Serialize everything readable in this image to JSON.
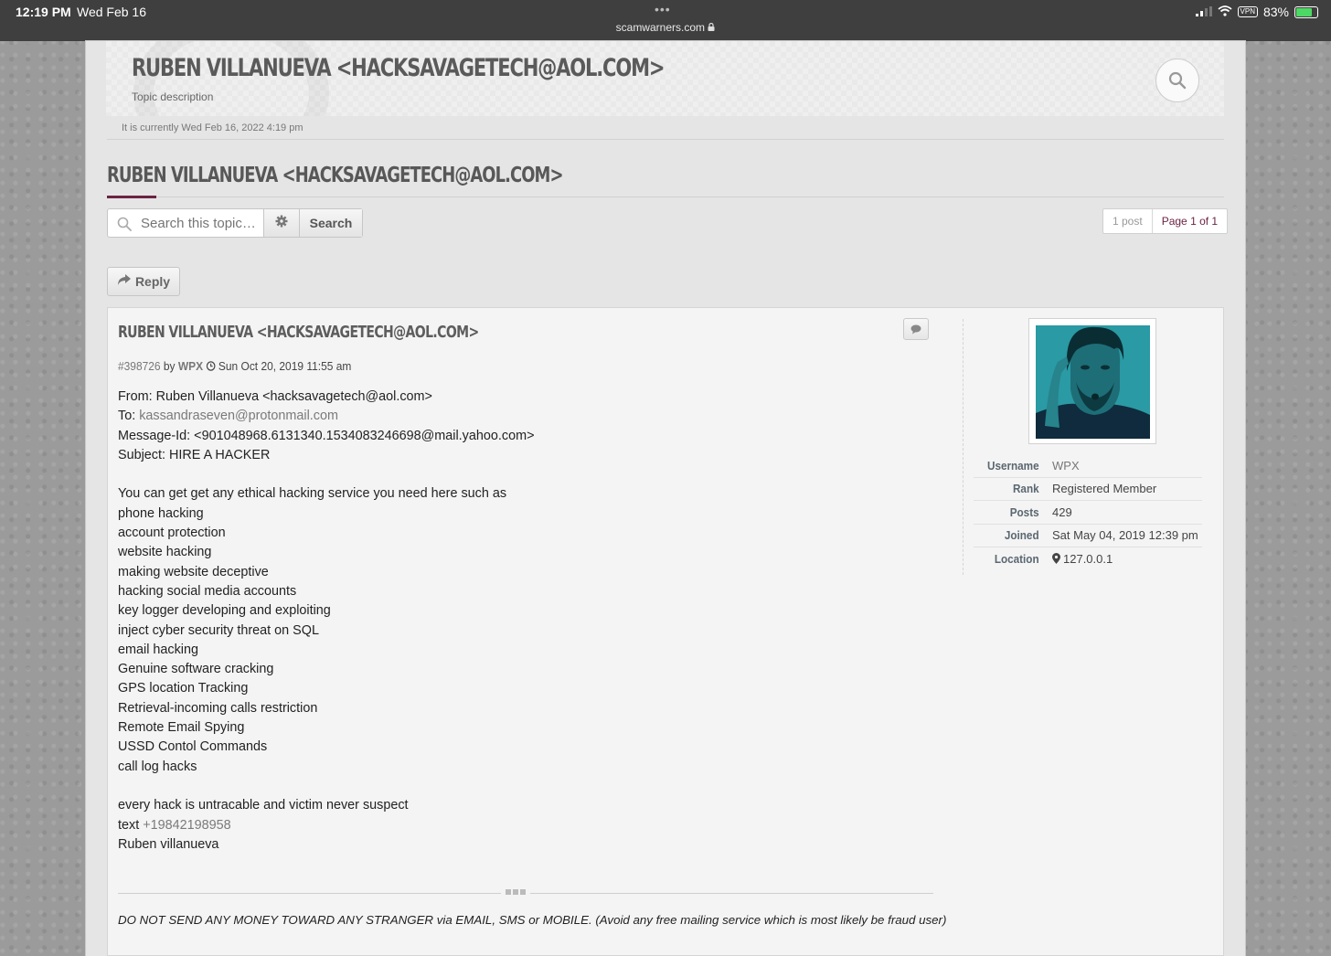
{
  "status_bar": {
    "time": "12:19 PM",
    "date": "Wed Feb 16",
    "dots": "•••",
    "url": "scamwarners.com",
    "vpn": "VPN",
    "battery": "83%"
  },
  "header": {
    "site_title": "RUBEN VILLANUEVA <HACKSAVAGETECH@AOL.COM>",
    "description": "Topic description"
  },
  "current_time": "It is currently Wed Feb 16, 2022 4:19 pm",
  "topic": {
    "title": "RUBEN VILLANUEVA <HACKSAVAGETECH@AOL.COM>",
    "search_placeholder": "Search this topic…",
    "search_label": "Search",
    "post_count": "1 post",
    "page_label": "Page 1 of 1",
    "reply_label": "Reply"
  },
  "post": {
    "title": "RUBEN VILLANUEVA <HACKSAVAGETECH@AOL.COM>",
    "id": "#398726",
    "by": "by",
    "author": "WPX",
    "datetime": "Sun Oct 20, 2019 11:55 am",
    "lines": [
      {
        "text": "From: Ruben Villanueva <hacksavagetech@aol.com>"
      },
      {
        "prefix": "To: ",
        "link": "kassandraseven@protonmail.com"
      },
      {
        "text": "Message-Id: <901048968.6131340.1534083246698@mail.yahoo.com>"
      },
      {
        "text": "Subject: HIRE A HACKER"
      },
      {
        "text": ""
      },
      {
        "text": "You can get get any ethical hacking service you need here such as"
      },
      {
        "text": "phone hacking"
      },
      {
        "text": "account protection"
      },
      {
        "text": "website hacking"
      },
      {
        "text": "making website deceptive"
      },
      {
        "text": "hacking social media accounts"
      },
      {
        "text": "key logger developing and exploiting"
      },
      {
        "text": "inject cyber security threat on SQL"
      },
      {
        "text": "email hacking"
      },
      {
        "text": "Genuine software cracking"
      },
      {
        "text": "GPS location Tracking"
      },
      {
        "text": "Retrieval-incoming calls restriction"
      },
      {
        "text": "Remote Email Spying"
      },
      {
        "text": "USSD Contol Commands"
      },
      {
        "text": "call log hacks"
      },
      {
        "text": ""
      },
      {
        "text": "every hack is untracable and victim never suspect"
      },
      {
        "prefix": "text ",
        "link": "+19842198958"
      },
      {
        "text": "Ruben villanueva"
      }
    ],
    "signature": "DO NOT SEND ANY MONEY TOWARD ANY STRANGER via EMAIL, SMS or MOBILE. (Avoid any free mailing service which is most likely be fraud user)"
  },
  "profile": {
    "rows": [
      {
        "label": "Username",
        "value": "WPX"
      },
      {
        "label": "Rank",
        "value": "Registered Member"
      },
      {
        "label": "Posts",
        "value": "429"
      },
      {
        "label": "Joined",
        "value": "Sat May 04, 2019 12:39 pm"
      },
      {
        "label": "Location",
        "value": "127.0.0.1"
      }
    ]
  }
}
